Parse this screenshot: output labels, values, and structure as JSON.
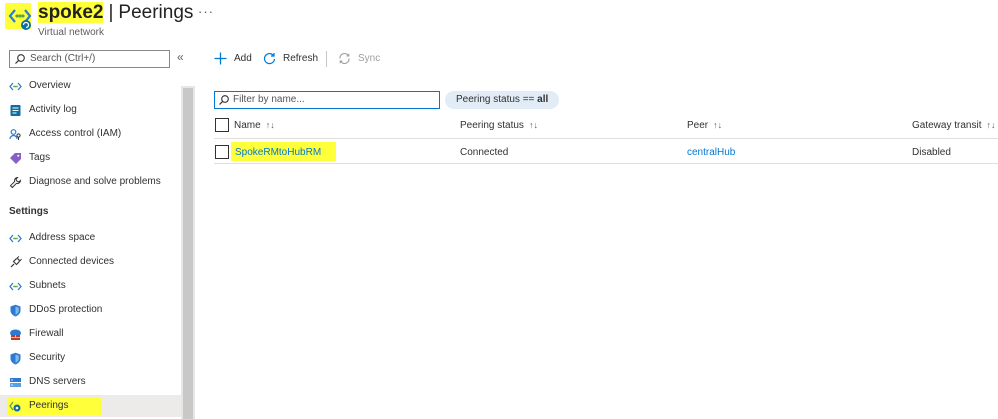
{
  "header": {
    "resource_name": "spoke2",
    "separator": "|",
    "page_name": "Peerings",
    "more": "···",
    "subtitle": "Virtual network"
  },
  "sidebar": {
    "search_placeholder": "Search (Ctrl+/)",
    "collapse_glyph": "«",
    "items_top": [
      {
        "label": "Overview",
        "icon": "vnet-icon"
      },
      {
        "label": "Activity log",
        "icon": "activity-log-icon"
      },
      {
        "label": "Access control (IAM)",
        "icon": "iam-icon"
      },
      {
        "label": "Tags",
        "icon": "tag-icon"
      },
      {
        "label": "Diagnose and solve problems",
        "icon": "wrench-icon"
      }
    ],
    "settings_header": "Settings",
    "items_settings": [
      {
        "label": "Address space",
        "icon": "vnet-icon"
      },
      {
        "label": "Connected devices",
        "icon": "plug-icon"
      },
      {
        "label": "Subnets",
        "icon": "vnet-icon"
      },
      {
        "label": "DDoS protection",
        "icon": "shield-icon"
      },
      {
        "label": "Firewall",
        "icon": "firewall-icon"
      },
      {
        "label": "Security",
        "icon": "shield-icon"
      },
      {
        "label": "DNS servers",
        "icon": "dns-icon"
      },
      {
        "label": "Peerings",
        "icon": "peering-icon",
        "selected": true
      }
    ]
  },
  "toolbar": {
    "add_label": "Add",
    "refresh_label": "Refresh",
    "sync_label": "Sync"
  },
  "filter": {
    "placeholder": "Filter by name...",
    "pill_prefix": "Peering status == ",
    "pill_value": "all"
  },
  "table": {
    "columns": [
      "Name",
      "Peering status",
      "Peer",
      "Gateway transit"
    ],
    "sort_glyph": "↑↓",
    "rows": [
      {
        "name": "SpokeRMtoHubRM",
        "status": "Connected",
        "peer": "centralHub",
        "gateway_transit": "Disabled"
      }
    ]
  },
  "colors": {
    "highlight": "#ffff3a",
    "link": "#0078d4",
    "accent": "#0078d4"
  }
}
